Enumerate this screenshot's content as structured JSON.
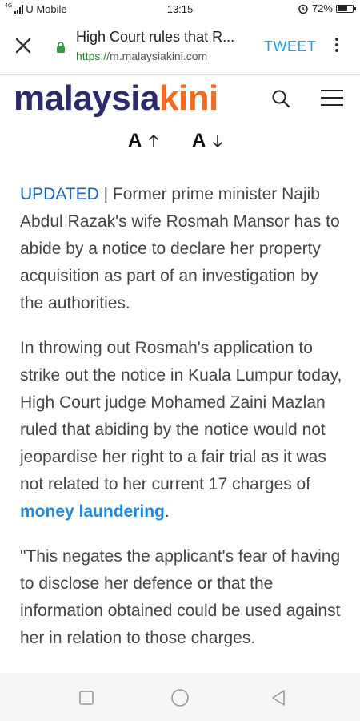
{
  "status": {
    "net_tag": "4G",
    "carrier": "U Mobile",
    "time": "13:15",
    "battery": "72%",
    "battery_level": 0.72
  },
  "browser": {
    "title": "High Court rules that R...",
    "url_protocol": "https://",
    "url_host": "m.malaysiakini.com",
    "tweet_label": "TWEET"
  },
  "site": {
    "logo_part1": "malaysia",
    "logo_part2": "kini"
  },
  "font_controls": {
    "increase_label": "A",
    "decrease_label": "A"
  },
  "article": {
    "p1_tag": "UPDATED",
    "p1_text": " | Former prime minister Najib Abdul Razak's wife Rosmah Mansor has to abide by a notice to declare her property acquisition as part of an investigation by the authorities.",
    "p2_text": "In throwing out Rosmah's application to strike out the notice in Kuala Lumpur today, High Court judge Mohamed Zaini Mazlan ruled that abiding by the notice would not jeopardise her right to a fair trial as it was not related to her current 17 charges of ",
    "p2_link": "money laundering",
    "p2_end": ".",
    "p3_text": "\"This negates the applicant's fear of having to disclose her defence or that the information obtained could be used against her in relation to those charges."
  },
  "colors": {
    "logo_dark": "#2b2a6c",
    "logo_orange": "#f26b21",
    "link_blue": "#1e88e5",
    "tweet_blue": "#1da1f2"
  }
}
